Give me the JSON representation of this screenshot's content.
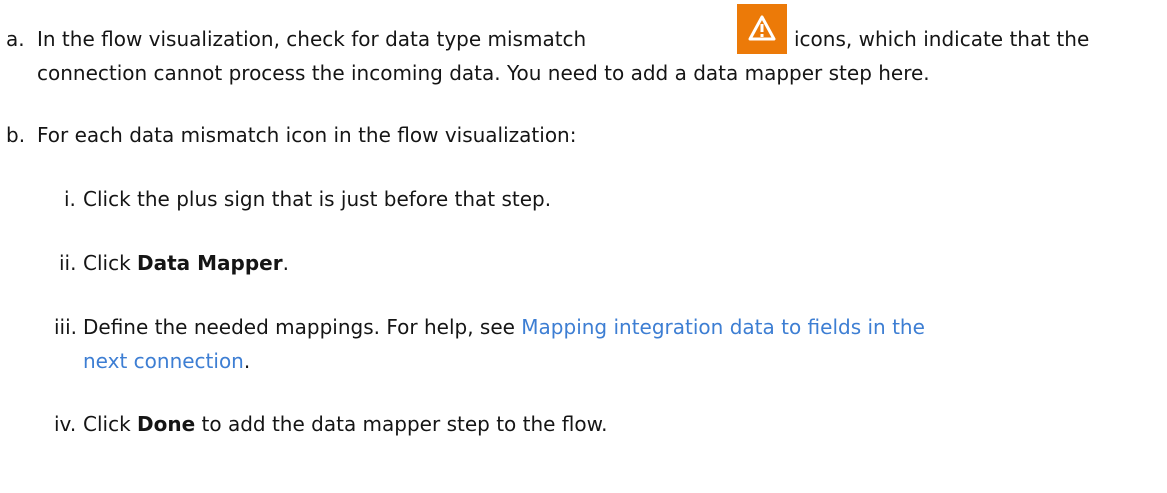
{
  "step_a": {
    "marker": "a.",
    "line1_before": "In the flow visualization, check for data type mismatch",
    "line1_after": "icons, which indicate that the",
    "line2": "connection cannot process the incoming data. You need to add a data mapper step here.",
    "icon": "warning-triangle-icon"
  },
  "step_b": {
    "marker": "b.",
    "text": "For each data mismatch icon in the flow visualization:"
  },
  "substeps": {
    "i": {
      "marker": "i.",
      "text": "Click the plus sign that is just before that step."
    },
    "ii": {
      "marker": "ii.",
      "before": "Click ",
      "bold": "Data Mapper",
      "after": "."
    },
    "iii": {
      "marker": "iii.",
      "before": "Define the needed mappings. For help, see ",
      "link_line1": "Mapping integration data to fields in the",
      "link_line2": "next connection",
      "after": "."
    },
    "iv": {
      "marker": "iv.",
      "before": "Click ",
      "bold": "Done",
      "after": " to add the data mapper step to the flow."
    }
  },
  "colors": {
    "text": "#151515",
    "link": "#3d7ed3",
    "warning": "#ec7a08"
  }
}
